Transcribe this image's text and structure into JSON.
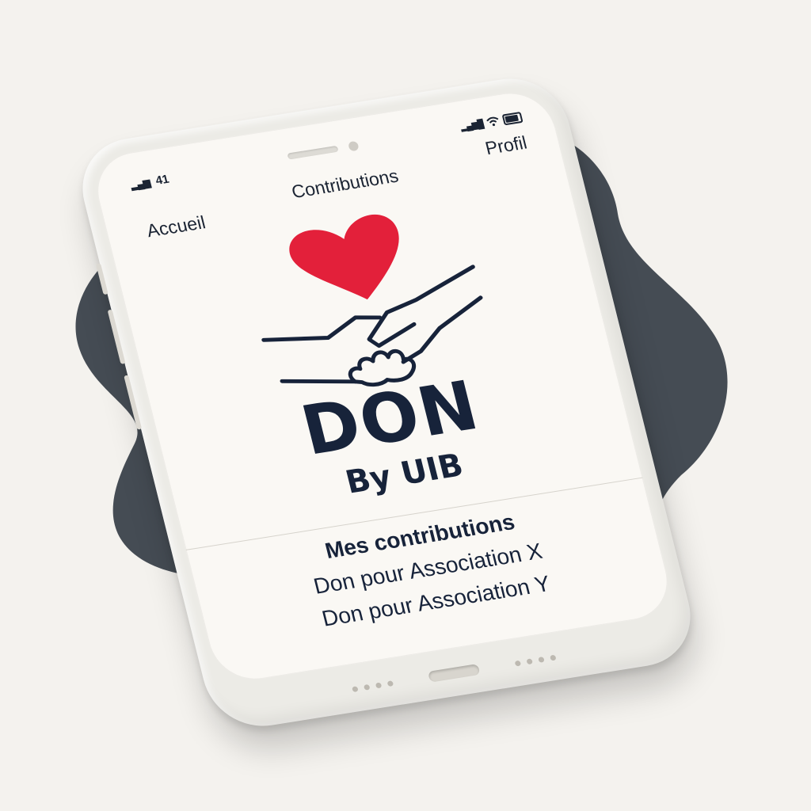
{
  "status_bar": {
    "signal_icon": "cellular-signal-icon",
    "carrier_text": "41",
    "right_icons": [
      "cellular-signal-icon",
      "wifi-icon",
      "battery-icon"
    ]
  },
  "nav": {
    "items": [
      {
        "label": "Accueil"
      },
      {
        "label": "Contributions"
      },
      {
        "label": "Profil"
      }
    ]
  },
  "logo": {
    "icon": "heart-handshake-icon",
    "heart_color": "#e3203a",
    "line_color": "#17233a"
  },
  "brand": {
    "title": "DON",
    "subtitle": "By UIB"
  },
  "contributions": {
    "heading": "Mes contributions",
    "items": [
      {
        "label": "Don pour Association X"
      },
      {
        "label": "Don pour Association Y"
      }
    ]
  },
  "colors": {
    "background": "#f4f2ee",
    "blob": "#454c54",
    "text": "#17233a",
    "accent": "#e3203a"
  }
}
